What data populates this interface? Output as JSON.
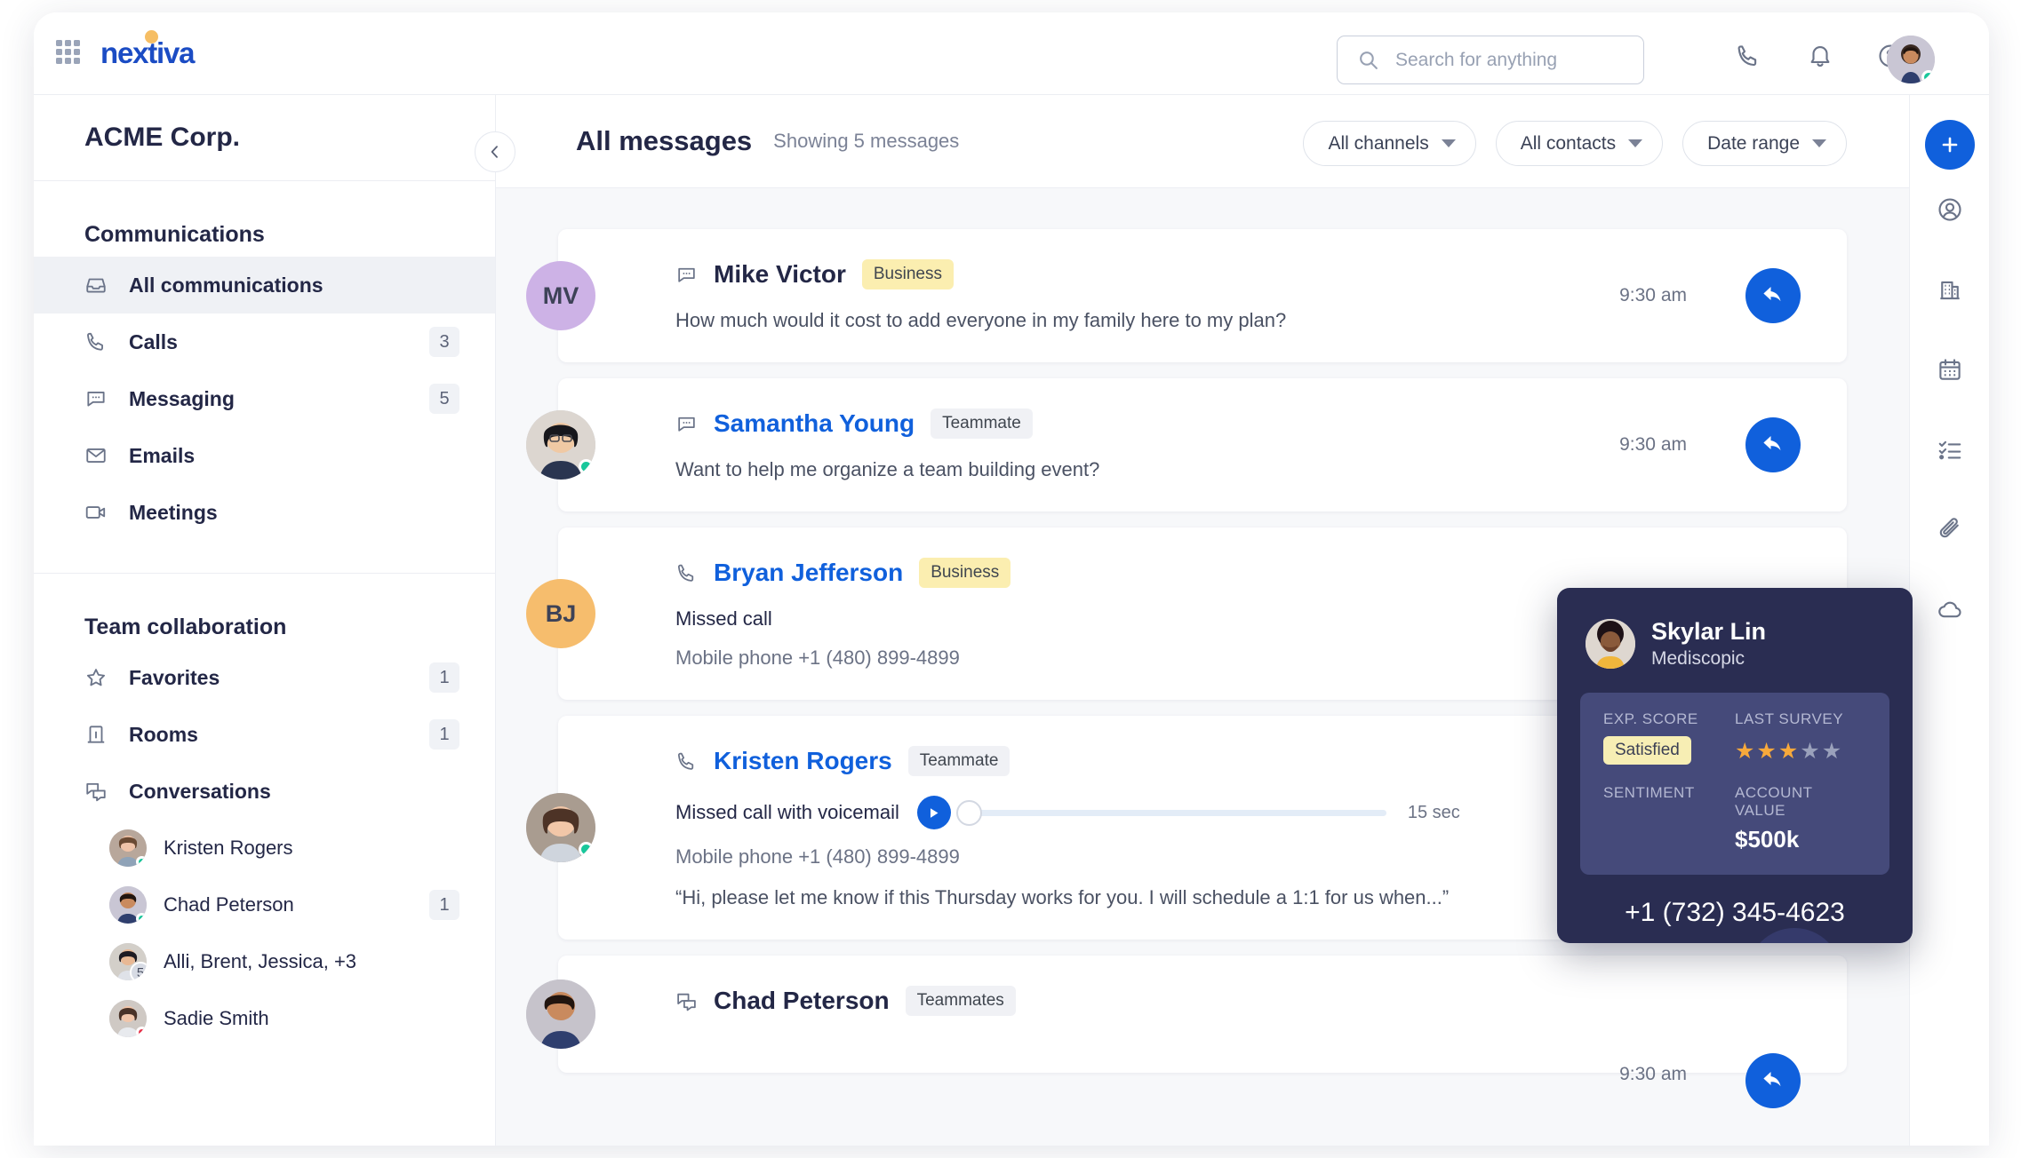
{
  "topbar": {
    "logo_text": "nextiva",
    "search_placeholder": "Search for anything",
    "icons": [
      "grid-icon",
      "phone-icon",
      "bell-icon",
      "help-icon",
      "avatar"
    ]
  },
  "sidebar": {
    "org_name": "ACME Corp.",
    "sections": [
      {
        "title": "Communications",
        "items": [
          {
            "label": "All communications",
            "icon": "inbox-icon",
            "badge": "",
            "active": true
          },
          {
            "label": "Calls",
            "icon": "phone-icon",
            "badge": "3",
            "active": false
          },
          {
            "label": "Messaging",
            "icon": "chat-icon",
            "badge": "5",
            "active": false
          },
          {
            "label": "Emails",
            "icon": "envelope-icon",
            "badge": "",
            "active": false
          },
          {
            "label": "Meetings",
            "icon": "video-icon",
            "badge": "",
            "active": false
          }
        ]
      },
      {
        "title": "Team collaboration",
        "items": [
          {
            "label": "Favorites",
            "icon": "star-icon",
            "badge": "1",
            "active": false
          },
          {
            "label": "Rooms",
            "icon": "building-icon",
            "badge": "1",
            "active": false
          },
          {
            "label": "Conversations",
            "icon": "conversations-icon",
            "badge": "",
            "active": false
          }
        ]
      }
    ],
    "conversations": [
      {
        "name": "Kristen Rogers",
        "status": "online",
        "badge": "",
        "count": ""
      },
      {
        "name": "Chad Peterson",
        "status": "online",
        "badge": "1",
        "count": ""
      },
      {
        "name": "Alli, Brent, Jessica, +3",
        "status": "",
        "badge": "",
        "count": "5"
      },
      {
        "name": "Sadie Smith",
        "status": "busy",
        "badge": "",
        "count": ""
      }
    ]
  },
  "main": {
    "title": "All messages",
    "subtitle": "Showing 5 messages",
    "filters": [
      "All channels",
      "All contacts",
      "Date range"
    ],
    "messages": [
      {
        "name": "Mike Victor",
        "name_style": "plain",
        "tag": "Business",
        "tag_type": "biz",
        "channel_icon": "chat-icon",
        "avatar_initials": "MV",
        "avatar_color": "#cdb2e6",
        "body": "How much would it cost to add everyone in my family here to my plan?",
        "time": "9:30 am"
      },
      {
        "name": "Samantha Young",
        "name_style": "link",
        "tag": "Teammate",
        "tag_type": "mate",
        "channel_icon": "chat-icon",
        "avatar_initials": "",
        "avatar_color": "#d6cfc9",
        "body": "Want to help me organize a team building event?",
        "time": "9:30 am"
      },
      {
        "name": "Bryan Jefferson",
        "name_style": "link",
        "tag": "Business",
        "tag_type": "biz",
        "channel_icon": "phone-icon",
        "avatar_initials": "BJ",
        "avatar_color": "#f6bd6d",
        "body": "Missed call",
        "sub": "Mobile phone +1 (480) 899-4899",
        "time": ""
      },
      {
        "name": "Kristen Rogers",
        "name_style": "link",
        "tag": "Teammate",
        "tag_type": "mate",
        "channel_icon": "phone-icon",
        "avatar_initials": "",
        "avatar_color": "#b8a79b",
        "body": "Missed call with voicemail",
        "duration": "15 sec",
        "sub": "Mobile phone +1 (480) 899-4899",
        "quote": "“Hi, please let me know if this Thursday works for you. I will schedule a 1:1 for us when...”",
        "time": ""
      },
      {
        "name": "Chad Peterson",
        "name_style": "plain",
        "tag": "Teammates",
        "tag_type": "mate",
        "channel_icon": "conversations-icon",
        "avatar_initials": "",
        "avatar_color": "#c6c3cb",
        "body": "",
        "time": "9:30 am"
      }
    ]
  },
  "rail": {
    "add_label": "+",
    "icons": [
      "contact-icon",
      "building-icon",
      "calendar-icon",
      "tasks-icon",
      "attachment-icon",
      "cloud-icon"
    ]
  },
  "call_popup": {
    "contact_name": "Skylar Lin",
    "company": "Mediscopic",
    "stats": [
      {
        "label": "EXP. SCORE",
        "type": "chip",
        "value": "Satisfied"
      },
      {
        "label": "LAST SURVEY",
        "type": "stars",
        "value": 3,
        "max": 5
      },
      {
        "label": "SENTIMENT",
        "type": "empty",
        "value": ""
      },
      {
        "label": "ACCOUNT VALUE",
        "type": "text",
        "value": "$500k"
      }
    ],
    "phone": "+1 (732) 345-4623",
    "decline_label": "decline-call",
    "accept_label": "accept-call"
  },
  "colors": {
    "accent_blue": "#1060dc",
    "popup_bg": "#2a2d52",
    "decline_red": "#f0334a",
    "accept_green": "#1ec8a5",
    "tag_yellow": "#fbeeb0",
    "star_on": "#f7a93b",
    "star_off": "#9aa1bb"
  }
}
